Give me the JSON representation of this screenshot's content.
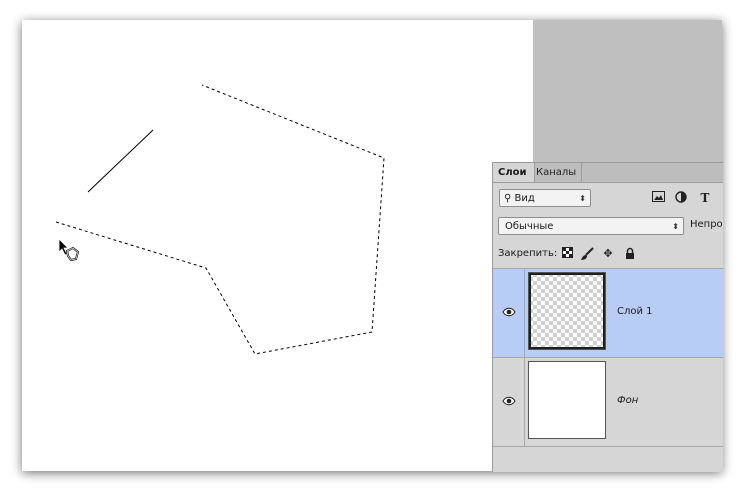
{
  "layers_panel": {
    "tabs": [
      {
        "label": "Слои",
        "active": true
      },
      {
        "label": "Каналы",
        "active": false
      }
    ],
    "filter": {
      "label": "Вид"
    },
    "blend_mode": {
      "value": "Обычные"
    },
    "opacity_label": "Непроз",
    "lock_label": "Закрепить:",
    "layers": [
      {
        "name": "Слой 1",
        "selected": true,
        "visible": true,
        "thumbnail": "transparent-checkerboard"
      },
      {
        "name": "Фон",
        "selected": false,
        "visible": true,
        "thumbnail": "white"
      }
    ]
  },
  "colors": {
    "selected_layer": "#b8cdf6",
    "panel_bg": "#d6d6d6",
    "workspace_bg": "#bfbfbf"
  },
  "canvas": {
    "selection": "marching-ants-polygon",
    "cursor": "polygonal-lasso-icon"
  }
}
